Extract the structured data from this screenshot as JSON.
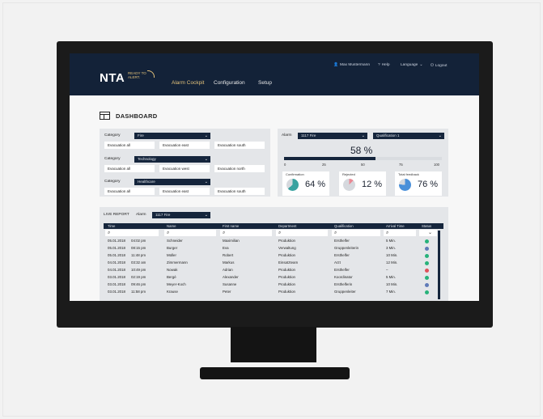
{
  "app": {
    "logo": "NTA",
    "logo_sub": "READY TO ALERT.",
    "nav": [
      "Alarm Cockpit",
      "Configuration",
      "Setup"
    ],
    "user": "Max Mustermann",
    "help": "Help",
    "language": "Language",
    "logout": "Logout"
  },
  "dashboard": {
    "title": "DASHBOARD",
    "categories": [
      {
        "label": "Category",
        "value": "Fire",
        "boxes": [
          "Evacuation all",
          "Evacuation east",
          "Evacuation south"
        ]
      },
      {
        "label": "Category",
        "value": "Technology",
        "boxes": [
          "Evacuation all",
          "Evacuation west",
          "Evacuation north"
        ]
      },
      {
        "label": "Category",
        "value": "Healthcare",
        "boxes": [
          "Evacuation all",
          "Evacuation east",
          "Evacuation south"
        ]
      }
    ],
    "alarm": {
      "label": "Alarm",
      "value": "1117 Fire",
      "qualification": "Qualification 1",
      "percent": "58 %",
      "progress": 0.58,
      "ticks": [
        "0",
        "25",
        "50",
        "75",
        "100"
      ]
    },
    "cards": [
      {
        "label": "Confirmation",
        "value": "64 %",
        "fraction": 0.64
      },
      {
        "label": "Rejected",
        "value": "12 %",
        "fraction": 0.12
      },
      {
        "label": "Total feedback",
        "value": "76 %",
        "fraction": 0.76
      }
    ]
  },
  "live_report": {
    "label": "LIVE REPORT",
    "alarm_label": "Alarm",
    "alarm_value": "1117 Fire",
    "columns": [
      "Time",
      "Name",
      "First name",
      "Department",
      "Qualification",
      "Arrival Time",
      "Status"
    ],
    "rows": [
      [
        "05.01.2018",
        "04:02 pm",
        "Schneider",
        "Maximilian",
        "Produktion",
        "Ersthelfer",
        "5 Min.",
        "ok"
      ],
      [
        "05.01.2018",
        "08:15 pm",
        "Burger",
        "Eva",
        "Verwaltung",
        "Gruppenleiterin",
        "3 Min.",
        "pending"
      ],
      [
        "05.01.2018",
        "11:48 pm",
        "Müller",
        "Robert",
        "Produktion",
        "Ersthelfer",
        "10 Min.",
        "ok"
      ],
      [
        "04.01.2018",
        "03:32 am",
        "Zimmermann",
        "Markus",
        "Einsatzteam",
        "Arzt",
        "12 Min.",
        "ok"
      ],
      [
        "04.01.2018",
        "10:49 pm",
        "Nowak",
        "Adrian",
        "Produktion",
        "Ersthelfer",
        "–",
        "rejected"
      ],
      [
        "03.01.2018",
        "02:19 pm",
        "Bergé",
        "Alexander",
        "Produktion",
        "Koordinator",
        "5 Min.",
        "ok"
      ],
      [
        "03.01.2018",
        "09:46 pm",
        "Meyer-Koch",
        "Susanne",
        "Produktion",
        "Ersthelferin",
        "10 Min.",
        "pending"
      ],
      [
        "03.01.2018",
        "11:58 pm",
        "Krause",
        "Peter",
        "Produktion",
        "Gruppenleiter",
        "7 Min.",
        "ok"
      ]
    ]
  },
  "colors": {
    "navy": "#132238",
    "accent": "#e2c17a",
    "status_ok": "#27b27a",
    "status_pending": "#5f7ab8",
    "status_rejected": "#e0505a",
    "pie_confirm": "#3aa2a0",
    "pie_reject": "#e98a95",
    "pie_total": "#4a90d9"
  }
}
